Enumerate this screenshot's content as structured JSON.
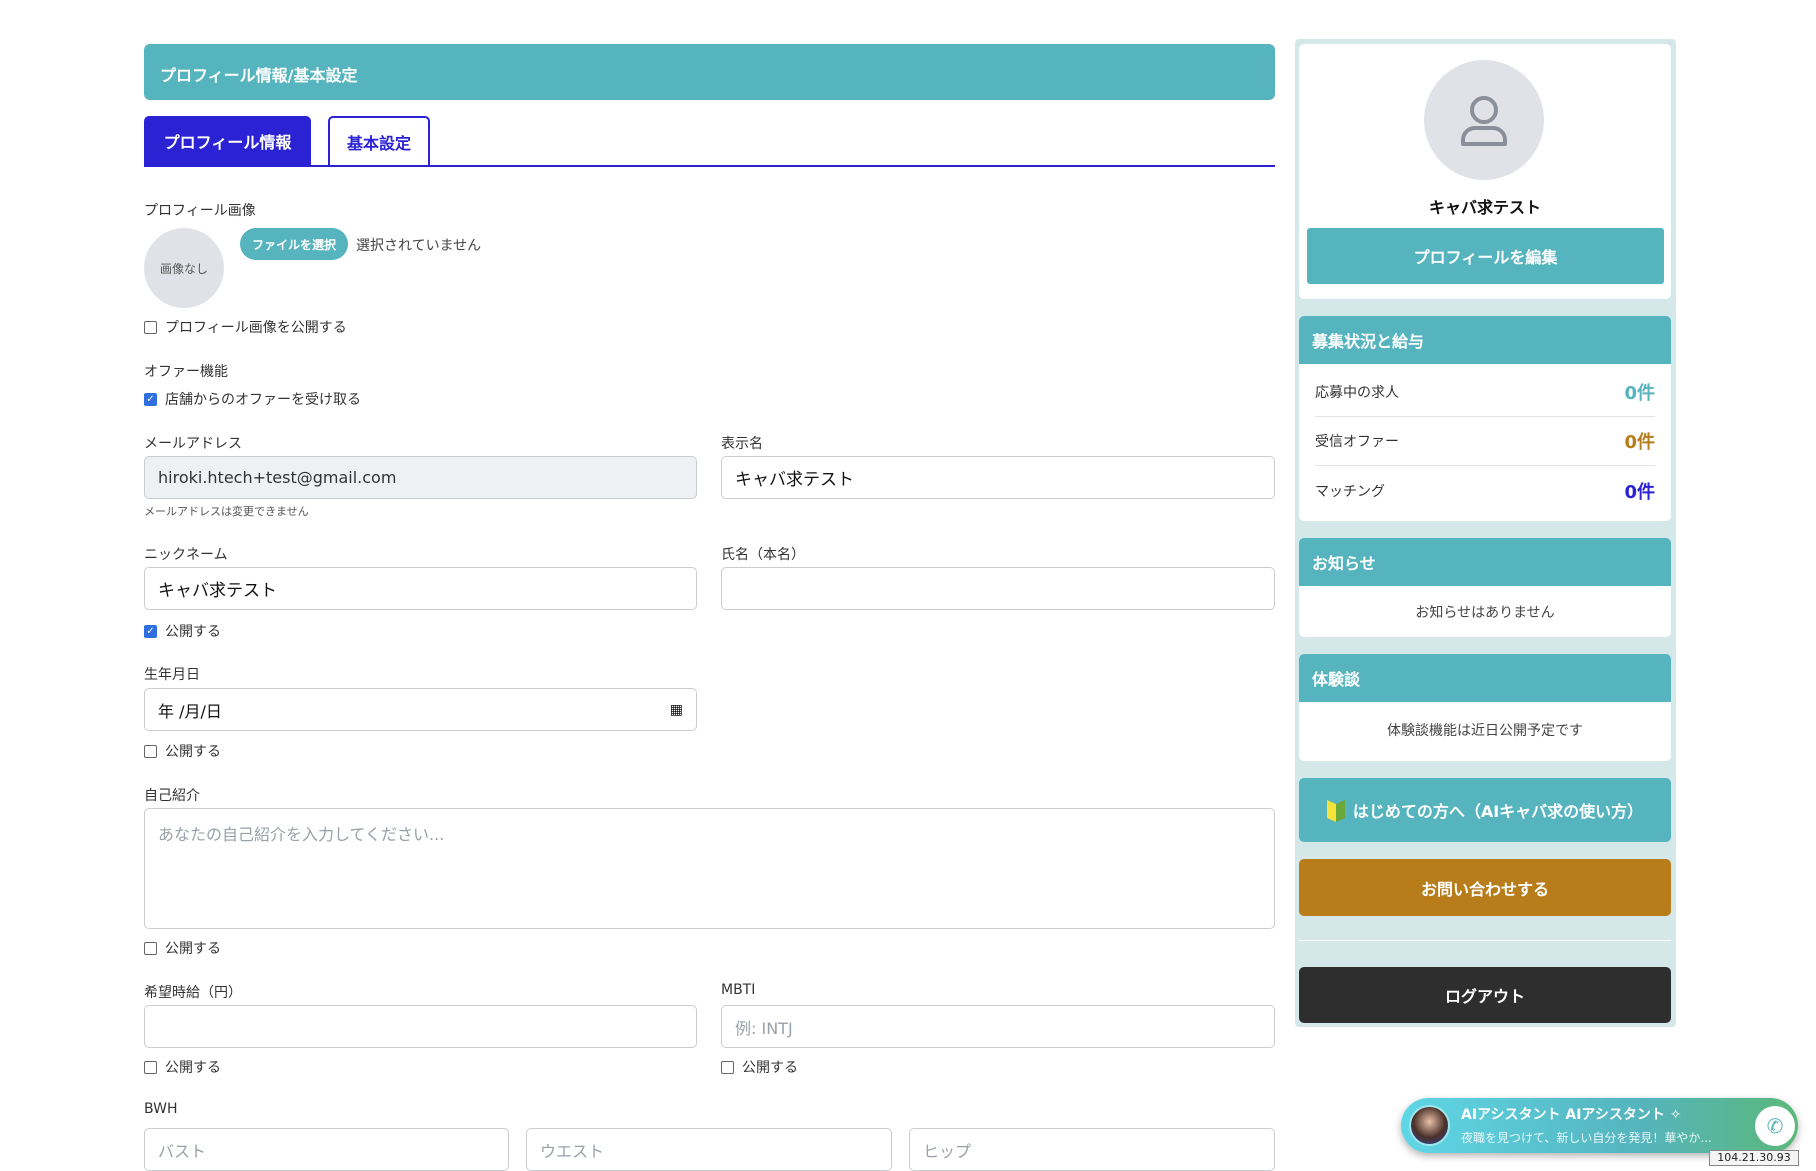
{
  "header": {
    "title": "プロフィール情報/基本設定"
  },
  "tabs": [
    {
      "label": "プロフィール情報",
      "active": true
    },
    {
      "label": "基本設定",
      "active": false
    }
  ],
  "form": {
    "profile_image": {
      "label": "プロフィール画像",
      "placeholder": "画像なし",
      "file_button": "ファイルを選択",
      "file_status": "選択されていません",
      "publish_label": "プロフィール画像を公開する",
      "publish": false
    },
    "offer": {
      "label": "オファー機能",
      "checkbox_label": "店舗からのオファーを受け取る",
      "checked": true
    },
    "email": {
      "label": "メールアドレス",
      "value": "hiroki.htech+test@gmail.com",
      "note": "メールアドレスは変更できません"
    },
    "display_name": {
      "label": "表示名",
      "value": "キャバ求テスト"
    },
    "nickname": {
      "label": "ニックネーム",
      "value": "キャバ求テスト",
      "publish_label": "公開する",
      "publish": true
    },
    "real_name": {
      "label": "氏名（本名）",
      "value": ""
    },
    "birthday": {
      "label": "生年月日",
      "value": "年 /月/日",
      "publish_label": "公開する",
      "publish": false
    },
    "intro": {
      "label": "自己紹介",
      "placeholder": "あなたの自己紹介を入力してください...",
      "publish_label": "公開する",
      "publish": false
    },
    "wage": {
      "label": "希望時給（円）",
      "value": "",
      "publish_label": "公開する",
      "publish": false
    },
    "mbti": {
      "label": "MBTI",
      "placeholder": "例: INTJ",
      "publish_label": "公開する",
      "publish": false
    },
    "bwh": {
      "label": "BWH",
      "bust": "バスト",
      "waist": "ウエスト",
      "hip": "ヒップ"
    }
  },
  "sidebar": {
    "name": "キャバ求テスト",
    "edit_button": "プロフィールを編集",
    "recruit": {
      "title": "募集状況と給与",
      "rows": [
        {
          "label": "応募中の求人",
          "value": "0件",
          "color": "#55b4bd"
        },
        {
          "label": "受信オファー",
          "value": "0件",
          "color": "#b87c1a"
        },
        {
          "label": "マッチング",
          "value": "0件",
          "color": "#2b22d4"
        }
      ]
    },
    "news": {
      "title": "お知らせ",
      "empty": "お知らせはありません"
    },
    "experience": {
      "title": "体験談",
      "empty": "体験談機能は近日公開予定です"
    },
    "beginner_button": "はじめての方へ（AIキャバ求の使い方）",
    "contact_button": "お問い合わせする",
    "logout_button": "ログアウト"
  },
  "assistant": {
    "title": "AIアシスタント AIアシスタント",
    "subtitle": "夜職を見つけて、新しい自分を発見！華やか..."
  },
  "ip": "104.21.30.93"
}
